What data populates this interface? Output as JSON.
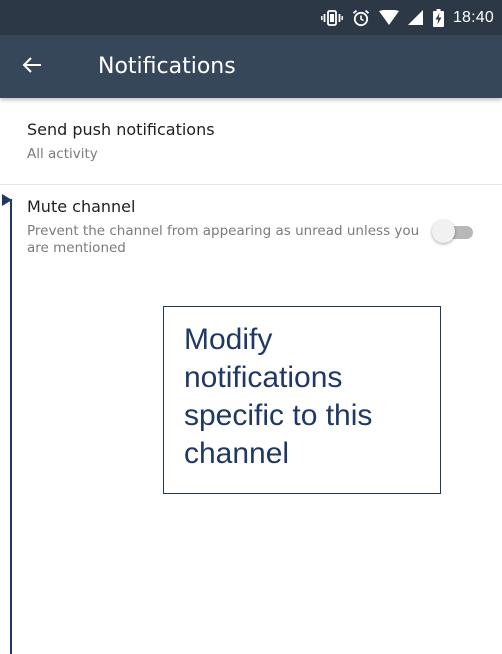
{
  "status_bar": {
    "time": "18:40",
    "icons": [
      "vibrate-icon",
      "alarm-icon",
      "wifi-icon",
      "cell-signal-icon",
      "battery-charging-icon"
    ]
  },
  "app_bar": {
    "back_icon": "arrow-left-icon",
    "title": "Notifications"
  },
  "settings": {
    "push": {
      "title": "Send push notifications",
      "value": "All activity"
    },
    "mute": {
      "title": "Mute channel",
      "description": "Prevent the channel from appearing as unread unless you are mentioned",
      "enabled": false
    }
  },
  "annotation": {
    "text": "Modify notifications specific to this channel"
  },
  "colors": {
    "status_bar": "#2c3845",
    "app_bar": "#37475a",
    "annotation": "#1f3864",
    "divider": "#e6e6e6"
  }
}
